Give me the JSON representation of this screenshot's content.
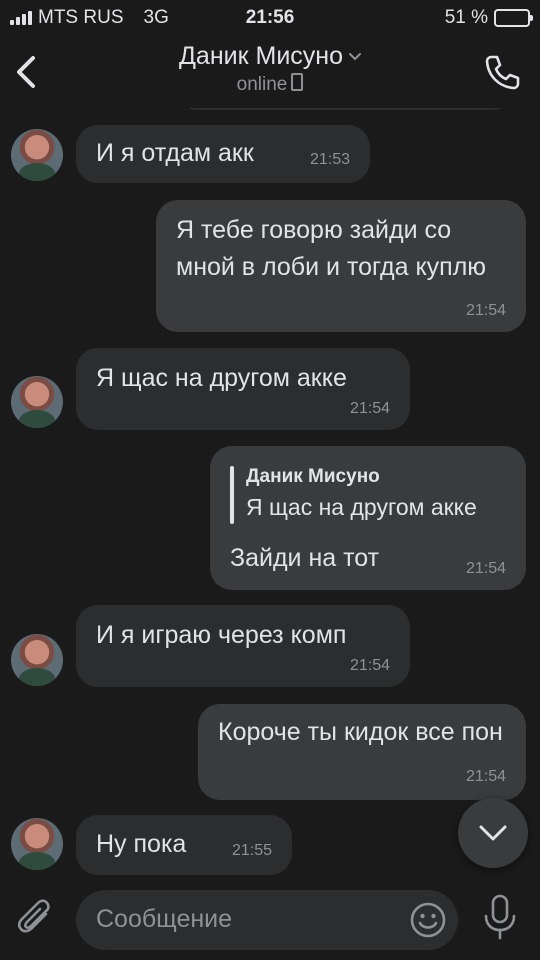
{
  "status_bar": {
    "carrier": "MTS RUS",
    "network": "3G",
    "time": "21:56",
    "battery": "51 %",
    "battery_level": 0.51
  },
  "header": {
    "title": "Даник Мисуно",
    "subtitle": "online"
  },
  "messages": [
    {
      "direction": "in",
      "text": "И я отдам акк",
      "time": "21:53"
    },
    {
      "direction": "out",
      "text": "Я тебе говорю зайди со мной в лоби и тогда куплю",
      "time": "21:54"
    },
    {
      "direction": "in",
      "text": "Я щас на другом акке",
      "time": "21:54"
    },
    {
      "direction": "out",
      "reply_to": {
        "name": "Даник Мисуно",
        "text": "Я щас на другом акке"
      },
      "text": "Зайди на тот",
      "time": "21:54"
    },
    {
      "direction": "in",
      "text": "И я играю через комп",
      "time": "21:54"
    },
    {
      "direction": "out",
      "text": "Короче ты кидок все пон",
      "time": "21:54"
    },
    {
      "direction": "in",
      "text": "Ну пока",
      "time": "21:55"
    }
  ],
  "composer": {
    "placeholder": "Сообщение"
  },
  "icons": {
    "back": "chevron-left-icon",
    "title_chevron": "chevron-down-icon",
    "call": "phone-icon",
    "device": "mobile-device-icon",
    "scroll_down": "chevron-down-icon",
    "attach": "paperclip-icon",
    "emoji": "emoji-icon",
    "mic": "microphone-icon"
  },
  "colors": {
    "background": "#1a1a1b",
    "incoming_bubble": "#2c2d2e",
    "outgoing_bubble": "#3a3b3c",
    "text": "#e1e3e6",
    "muted": "#8e9297"
  }
}
